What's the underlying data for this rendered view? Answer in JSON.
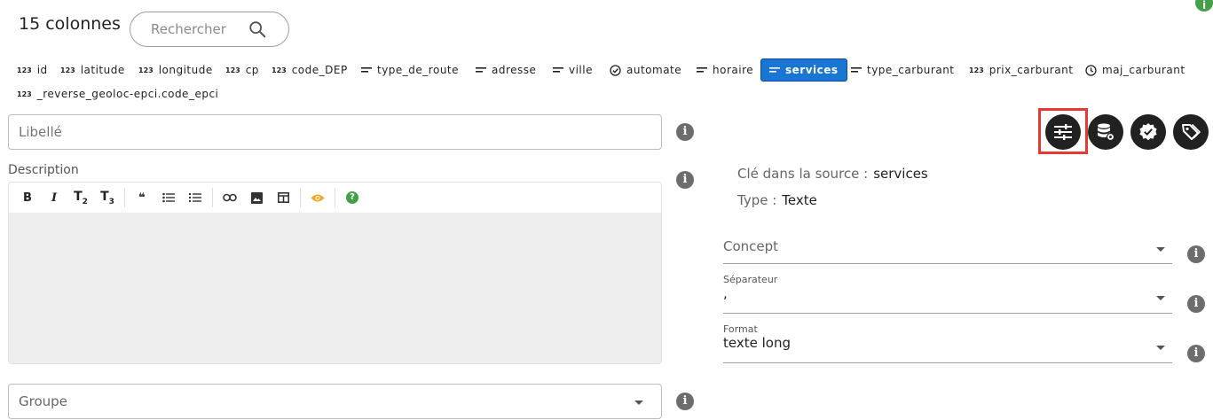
{
  "header": {
    "title": "15 colonnes",
    "search_placeholder": "Rechercher"
  },
  "columns": [
    {
      "label": "id",
      "type": "number",
      "active": false
    },
    {
      "label": "latitude",
      "type": "number",
      "active": false
    },
    {
      "label": "longitude",
      "type": "number",
      "active": false
    },
    {
      "label": "cp",
      "type": "number",
      "active": false
    },
    {
      "label": "code_DEP",
      "type": "number",
      "active": false
    },
    {
      "label": "type_de_route",
      "type": "text",
      "active": false
    },
    {
      "label": "adresse",
      "type": "text",
      "active": false
    },
    {
      "label": "ville",
      "type": "text",
      "active": false
    },
    {
      "label": "automate",
      "type": "boolean",
      "active": false
    },
    {
      "label": "horaire",
      "type": "text",
      "active": false
    },
    {
      "label": "services",
      "type": "text",
      "active": true
    },
    {
      "label": "type_carburant",
      "type": "text",
      "active": false
    },
    {
      "label": "prix_carburant",
      "type": "number",
      "active": false
    },
    {
      "label": "maj_carburant",
      "type": "datetime",
      "active": false
    },
    {
      "label": "_reverse_geoloc-epci.code_epci",
      "type": "number",
      "active": false
    }
  ],
  "type_icons": {
    "number": "123",
    "text": "text-lines-icon",
    "boolean": "check-circle-icon",
    "datetime": "clock-icon"
  },
  "form": {
    "libelle_placeholder": "Libellé",
    "description_label": "Description",
    "groupe_placeholder": "Groupe"
  },
  "editor_toolbar": [
    {
      "name": "bold",
      "label": "B"
    },
    {
      "name": "italic",
      "label": "I"
    },
    {
      "name": "heading2",
      "label": "T2"
    },
    {
      "name": "heading3",
      "label": "T3"
    },
    {
      "name": "quote",
      "label": "❝"
    },
    {
      "name": "bullet-list",
      "label": "☰"
    },
    {
      "name": "numbered-list",
      "label": "≡"
    },
    {
      "name": "link",
      "label": "⛓"
    },
    {
      "name": "image",
      "label": "▣"
    },
    {
      "name": "table",
      "label": "⊞"
    },
    {
      "name": "preview",
      "label": "👁"
    },
    {
      "name": "help",
      "label": "?"
    }
  ],
  "details": {
    "source_key_label": "Clé dans la source :",
    "source_key_value": "services",
    "type_label": "Type :",
    "type_value": "Texte"
  },
  "concept": {
    "placeholder": "Concept"
  },
  "separator": {
    "label": "Séparateur",
    "value": ","
  },
  "format": {
    "label": "Format",
    "value": "texte long"
  },
  "colors": {
    "accent": "#1976d2",
    "dark_button": "#212121",
    "highlight": "#e53935",
    "info_green": "#43a047"
  }
}
